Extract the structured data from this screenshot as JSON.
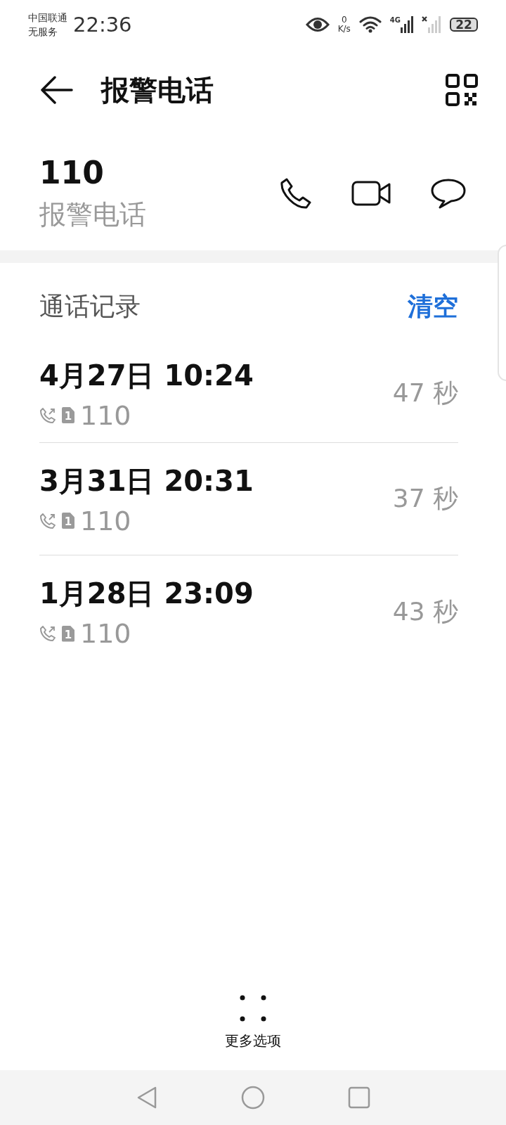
{
  "status_bar": {
    "carrier": "中国联通",
    "service": "无服务",
    "time": "22:36",
    "net_speed_value": "0",
    "net_speed_unit": "K/s",
    "network_type": "4G",
    "battery": "22"
  },
  "header": {
    "title": "报警电话"
  },
  "contact": {
    "number": "110",
    "label": "报警电话"
  },
  "call_log": {
    "title": "通话记录",
    "clear": "清空",
    "entries": [
      {
        "datetime": "4月27日 10:24",
        "sim": "1",
        "number": "110",
        "duration": "47 秒"
      },
      {
        "datetime": "3月31日 20:31",
        "sim": "1",
        "number": "110",
        "duration": "37 秒"
      },
      {
        "datetime": "1月28日 23:09",
        "sim": "1",
        "number": "110",
        "duration": "43 秒"
      }
    ]
  },
  "more_options": {
    "label": "更多选项"
  }
}
